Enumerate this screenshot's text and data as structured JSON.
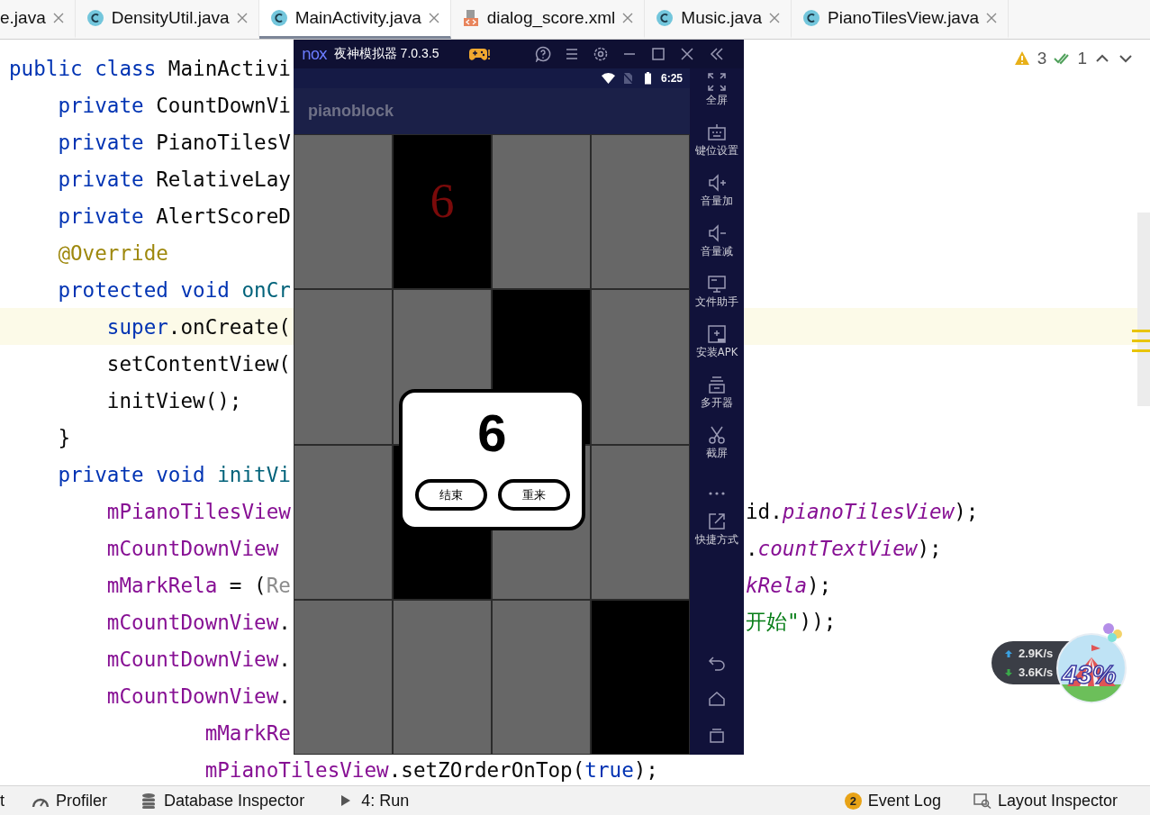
{
  "tabs": [
    {
      "label": "e.java",
      "selected": false
    },
    {
      "label": "DensityUtil.java",
      "kind": "class",
      "selected": false
    },
    {
      "label": "MainActivity.java",
      "kind": "class",
      "selected": true
    },
    {
      "label": "dialog_score.xml",
      "kind": "layout",
      "selected": false
    },
    {
      "label": "Music.java",
      "kind": "class",
      "selected": false
    },
    {
      "label": "PianoTilesView.java",
      "kind": "class",
      "selected": false
    }
  ],
  "editor": {
    "inspections": {
      "warnings": "3",
      "weak_warnings": "1"
    },
    "lines": [
      {
        "highlighted": false,
        "left": [
          {
            "text": "public class ",
            "kind": "keyword"
          },
          {
            "text": "MainActivi",
            "kind": "plain"
          }
        ]
      },
      {
        "highlighted": false,
        "left": [
          {
            "text": "    private ",
            "kind": "keyword"
          },
          {
            "text": "CountDownVi",
            "kind": "plain"
          }
        ]
      },
      {
        "highlighted": false,
        "left": [
          {
            "text": "    private ",
            "kind": "keyword"
          },
          {
            "text": "PianoTilesV",
            "kind": "plain"
          }
        ]
      },
      {
        "highlighted": false,
        "left": [
          {
            "text": "    private ",
            "kind": "keyword"
          },
          {
            "text": "RelativeLay",
            "kind": "plain"
          }
        ]
      },
      {
        "highlighted": false,
        "left": [
          {
            "text": "    private ",
            "kind": "keyword"
          },
          {
            "text": "AlertScoreD",
            "kind": "plain"
          }
        ]
      },
      {
        "highlighted": false,
        "left": [
          {
            "text": "    @Override",
            "kind": "annotation"
          }
        ]
      },
      {
        "highlighted": false,
        "left": [
          {
            "text": "    protected void ",
            "kind": "keyword"
          },
          {
            "text": "onCr",
            "kind": "method"
          }
        ]
      },
      {
        "highlighted": true,
        "left": [
          {
            "text": "        super",
            "kind": "keyword"
          },
          {
            "text": ".onCreate(",
            "kind": "plain"
          }
        ]
      },
      {
        "highlighted": false,
        "left": [
          {
            "text": "        setContentView(",
            "kind": "plain"
          }
        ]
      },
      {
        "highlighted": false,
        "left": [
          {
            "text": "        initView();",
            "kind": "plain"
          }
        ]
      },
      {
        "highlighted": false,
        "left": [
          {
            "text": "    }",
            "kind": "plain"
          }
        ]
      },
      {
        "highlighted": false,
        "left": [
          {
            "text": "    private void ",
            "kind": "keyword"
          },
          {
            "text": "initVi",
            "kind": "method"
          }
        ]
      },
      {
        "highlighted": false,
        "left": [
          {
            "text": "        mPianoTilesView",
            "kind": "field"
          }
        ],
        "right": [
          {
            "text": "id.",
            "kind": "plain"
          },
          {
            "text": "pianoTilesView",
            "kind": "static_field"
          },
          {
            "text": ");",
            "kind": "plain"
          }
        ]
      },
      {
        "highlighted": false,
        "left": [
          {
            "text": "        mCountDownView",
            "kind": "field"
          }
        ],
        "right": [
          {
            "text": ".",
            "kind": "plain"
          },
          {
            "text": "countTextView",
            "kind": "static_field"
          },
          {
            "text": ");",
            "kind": "plain"
          }
        ]
      },
      {
        "highlighted": false,
        "left": [
          {
            "text": "        mMarkRela",
            "kind": "field"
          },
          {
            "text": " = (",
            "kind": "plain"
          },
          {
            "text": "Re",
            "kind": "muted"
          }
        ],
        "right": [
          {
            "text": "kRela",
            "kind": "static_field"
          },
          {
            "text": ");",
            "kind": "plain"
          }
        ]
      },
      {
        "highlighted": false,
        "left": [
          {
            "text": "        mCountDownView",
            "kind": "field"
          },
          {
            "text": ".",
            "kind": "plain"
          }
        ],
        "right": [
          {
            "text": "开始\"",
            "kind": "string"
          },
          {
            "text": "));",
            "kind": "plain"
          }
        ]
      },
      {
        "highlighted": false,
        "left": [
          {
            "text": "        mCountDownView",
            "kind": "field"
          },
          {
            "text": ".",
            "kind": "plain"
          }
        ]
      },
      {
        "highlighted": false,
        "left": [
          {
            "text": "        mCountDownView",
            "kind": "field"
          },
          {
            "text": ".",
            "kind": "plain"
          }
        ]
      },
      {
        "highlighted": false,
        "left": [
          {
            "text": "                mMarkRe",
            "kind": "field"
          }
        ]
      },
      {
        "highlighted": false,
        "left": [
          {
            "text": "                mPianoTilesView",
            "kind": "field"
          },
          {
            "text": ".setZOrderOnTop(",
            "kind": "plain"
          },
          {
            "text": "true",
            "kind": "keyword"
          },
          {
            "text": ");",
            "kind": "plain"
          }
        ]
      }
    ]
  },
  "emulator": {
    "logo": "nox",
    "title": "夜神模拟器 7.0.3.5",
    "status_time": "6:25",
    "app_title": "pianoblock",
    "tile_rows": [
      {
        "tiles": [
          {
            "dark": false
          },
          {
            "dark": true,
            "counter": "6"
          },
          {
            "dark": false
          },
          {
            "dark": false
          }
        ]
      },
      {
        "tiles": [
          {
            "dark": false
          },
          {
            "dark": false
          },
          {
            "dark": true
          },
          {
            "dark": false
          }
        ]
      },
      {
        "tiles": [
          {
            "dark": false
          },
          {
            "dark": true
          },
          {
            "dark": false
          },
          {
            "dark": false
          }
        ]
      },
      {
        "tiles": [
          {
            "dark": false
          },
          {
            "dark": false
          },
          {
            "dark": false
          },
          {
            "dark": true
          }
        ]
      }
    ],
    "dialog": {
      "score": "6",
      "buttons": [
        "结束",
        "重来"
      ]
    },
    "sidebar": [
      {
        "kind": "fullscreen",
        "label": "全屏"
      },
      {
        "kind": "keyboard",
        "label": "键位设置"
      },
      {
        "kind": "volumeup",
        "label": "音量加"
      },
      {
        "kind": "volumedown",
        "label": "音量减"
      },
      {
        "kind": "monitor",
        "label": "文件助手"
      },
      {
        "kind": "apk",
        "label": "安装APK"
      },
      {
        "kind": "multi",
        "label": "多开器"
      },
      {
        "kind": "scissors",
        "label": "截屏"
      },
      {
        "kind": "more"
      },
      {
        "kind": "share",
        "label": "快捷方式"
      }
    ]
  },
  "network_widget": {
    "upload": "2.9K/s",
    "download": "3.6K/s",
    "percent": "43%"
  },
  "bottom_bar": {
    "left": [
      {
        "label": "t"
      },
      {
        "kind": "gauge",
        "label": "Profiler"
      },
      {
        "kind": "database",
        "label": "Database Inspector"
      },
      {
        "kind": "run",
        "label": "4: Run"
      }
    ],
    "right": [
      {
        "badge": "2",
        "label": "Event Log"
      },
      {
        "kind": "inspector",
        "label": "Layout Inspector"
      }
    ]
  }
}
